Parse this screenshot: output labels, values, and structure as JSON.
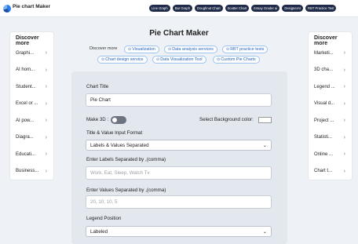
{
  "app": {
    "brand": "Pie chart Maker"
  },
  "nav": [
    "Line Graph",
    "Bar Graph",
    "Doughnut Chart",
    "Scatter Chart",
    "Essay Grader ai",
    "DesignerAI",
    "RBT Practice Test"
  ],
  "sidebar_left": {
    "title": "Discover more",
    "items": [
      "Graphi...",
      "AI hom...",
      "Student...",
      "Excel or ...",
      "AI pow...",
      "Diagra...",
      "Educati...",
      "Business..."
    ]
  },
  "sidebar_right": {
    "title": "Discover more",
    "items": [
      "Marketi...",
      "3D cha...",
      "Legend ...",
      "Visual d...",
      "Project ...",
      "Statisti...",
      "Online ...",
      "Chart t..."
    ]
  },
  "main": {
    "page_title": "Pie Chart Maker",
    "discover_label": "Discover more",
    "chips": [
      "Visualization",
      "Data analysis services",
      "RBT practice tests",
      "Chart design service",
      "Data Visualization Tool",
      "Custom Pie Charts"
    ],
    "chart_title_label": "Chart Title",
    "chart_title_value": "Pie Chart",
    "make3d_label": "Make 3D :",
    "make3d_on": false,
    "bg_color_label": "Select Background color:",
    "bg_color": "#ffffff",
    "input_format_label": "Title & Value Input Format",
    "input_format_value": "Labels & Values Separated",
    "labels_label": "Enter Labels Separated by ,(comma)",
    "labels_placeholder": "Work, Eat, Sleep, Watch Tv",
    "values_label": "Enter Values Separated by ,(comma)",
    "values_placeholder": "20, 10, 10, 5",
    "legend_label": "Legend Position",
    "legend_value": "Labeled"
  },
  "colors": {
    "nav_bg": "#1f2b49",
    "accent": "#2a64b8",
    "panel": "#e3e8ef"
  }
}
